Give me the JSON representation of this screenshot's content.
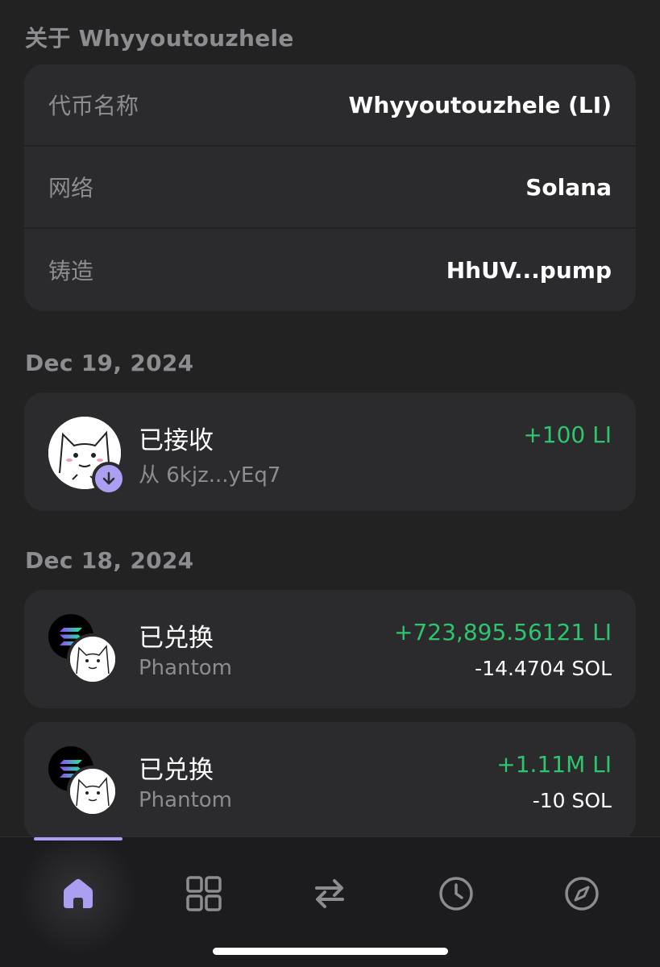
{
  "about": {
    "title": "关于 Whyyoutouzhele",
    "rows": [
      {
        "label": "代币名称",
        "value": "Whyyoutouzhele (LI)"
      },
      {
        "label": "网络",
        "value": "Solana"
      },
      {
        "label": "铸造",
        "value": "HhUV...pump"
      }
    ]
  },
  "groups": [
    {
      "date": "Dec 19, 2024",
      "transactions": [
        {
          "title": "已接收",
          "subtitle": "从 6kjz...yEq7",
          "amount": "+100 LI"
        }
      ]
    },
    {
      "date": "Dec 18, 2024",
      "transactions": [
        {
          "title": "已兑换",
          "subtitle": "Phantom",
          "amount_in": "+723,895.56121 LI",
          "amount_out": "-14.4704 SOL"
        },
        {
          "title": "已兑换",
          "subtitle": "Phantom",
          "amount_in": "+1.11M LI",
          "amount_out": "-10 SOL"
        }
      ]
    }
  ],
  "nav": {
    "items": [
      "home-icon",
      "grid-icon",
      "swap-icon",
      "clock-icon",
      "compass-icon"
    ],
    "active": "home-icon"
  },
  "colors": {
    "background": "#222222",
    "card": "#2b2b2e",
    "accent": "#ab9ff2",
    "positive": "#2ec66d",
    "muted": "#8d8d91"
  }
}
